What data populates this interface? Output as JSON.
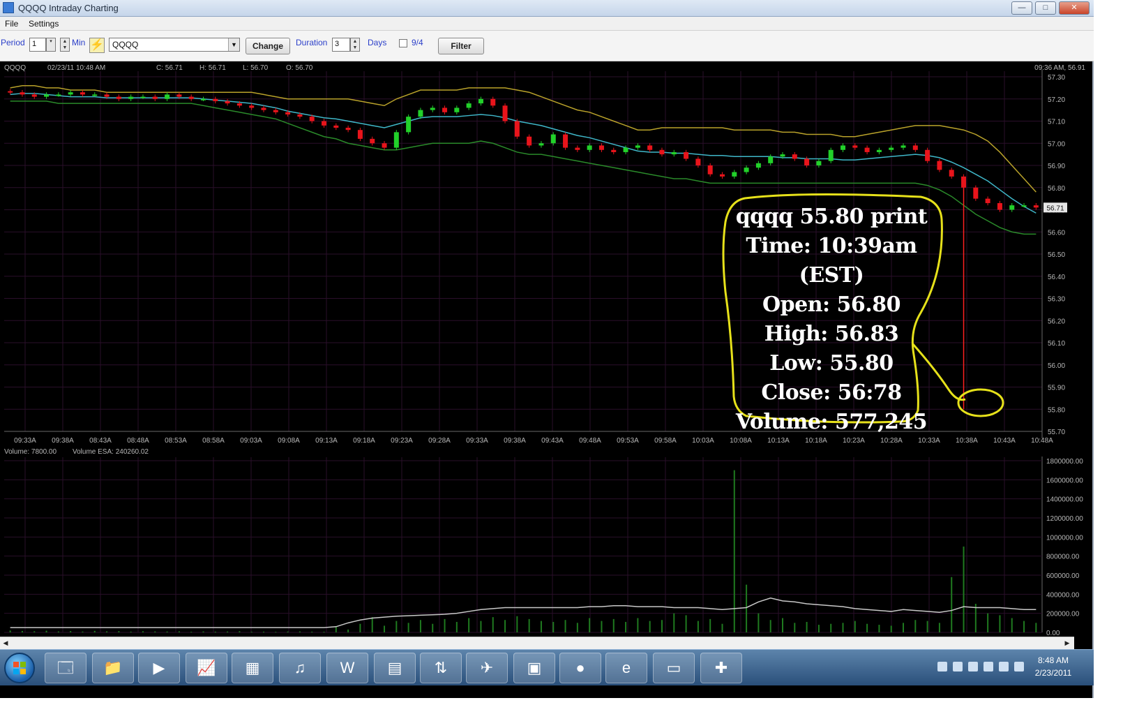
{
  "window": {
    "title": "QQQQ Intraday Charting",
    "controls": {
      "minimize": "—",
      "maximize": "□",
      "close": "✕"
    }
  },
  "menu": [
    "File",
    "Settings"
  ],
  "toolbar": {
    "period_label": "Period",
    "period_value": "1",
    "min_label": "Min",
    "symbol_value": "QQQQ",
    "change_label": "Change",
    "duration_label": "Duration",
    "duration_value": "3",
    "days_label": "Days",
    "checkbox_label": "9/4",
    "filter_label": "Filter"
  },
  "chart_header": {
    "symbol": "QQQQ",
    "datetime": "02/23/11 10:48 AM",
    "close": "C: 56.71",
    "high": "H: 56.71",
    "low": "L: 56.70",
    "open": "O: 56.70",
    "right": "09:36 AM, 56.91"
  },
  "price_axis": {
    "ticks": [
      "57.30",
      "57.20",
      "57.10",
      "57.00",
      "56.90",
      "56.80",
      "56.70",
      "56.60",
      "56.50",
      "56.40",
      "56.30",
      "56.20",
      "56.10",
      "56.00",
      "55.90",
      "55.80",
      "55.70"
    ],
    "current": "56.71"
  },
  "time_axis": [
    "09:33A",
    "09:38A",
    "08:43A",
    "08:48A",
    "08:53A",
    "08:58A",
    "09:03A",
    "09:08A",
    "09:13A",
    "09:18A",
    "09:23A",
    "09:28A",
    "09:33A",
    "09:38A",
    "09:43A",
    "09:48A",
    "09:53A",
    "09:58A",
    "10:03A",
    "10:08A",
    "10:13A",
    "10:18A",
    "10:23A",
    "10:28A",
    "10:33A",
    "10:38A",
    "10:43A",
    "10:48A"
  ],
  "volume_header": {
    "volume": "Volume: 7800.00",
    "volume_esa": "Volume ESA: 240260.02"
  },
  "volume_axis": [
    "1800000.00",
    "1600000.00",
    "1400000.00",
    "1200000.00",
    "1000000.00",
    "800000.00",
    "600000.00",
    "400000.00",
    "200000.00",
    "0.00"
  ],
  "annotation": {
    "lines": [
      "qqqq 55.80 print",
      "Time: 10:39am (EST)",
      "Open: 56.80",
      "High: 56.83",
      "Low: 55.80",
      "Close: 56:78",
      "Volume: 577,245"
    ],
    "color": "#e6e11a"
  },
  "colors": {
    "up": "#22d12a",
    "down": "#e8141b",
    "band_upper": "#b9a22a",
    "band_lower": "#2a8a2a",
    "ma": "#3fb7c9",
    "grid": "#2a0f2a",
    "axis_text": "#b8b8b8",
    "spike": "#ff2020"
  },
  "chart_data": {
    "type": "candlestick",
    "title": "",
    "ylim": [
      55.7,
      57.3
    ],
    "spike_low": 55.8,
    "candles_close": [
      57.23,
      57.22,
      57.21,
      57.22,
      57.22,
      57.23,
      57.22,
      57.22,
      57.21,
      57.2,
      57.21,
      57.21,
      57.2,
      57.22,
      57.21,
      57.2,
      57.2,
      57.19,
      57.18,
      57.17,
      57.16,
      57.15,
      57.14,
      57.13,
      57.12,
      57.1,
      57.08,
      57.07,
      57.06,
      57.02,
      57.0,
      56.98,
      57.05,
      57.12,
      57.15,
      57.16,
      57.14,
      57.16,
      57.18,
      57.2,
      57.17,
      57.1,
      57.03,
      56.99,
      57.0,
      57.04,
      56.98,
      56.97,
      56.99,
      56.97,
      56.96,
      56.98,
      56.99,
      56.97,
      56.95,
      56.96,
      56.93,
      56.9,
      56.86,
      56.85,
      56.87,
      56.89,
      56.91,
      56.94,
      56.95,
      56.93,
      56.9,
      56.92,
      56.97,
      56.99,
      56.98,
      56.96,
      56.97,
      56.98,
      56.99,
      56.97,
      56.92,
      56.88,
      56.85,
      56.8,
      56.75,
      56.73,
      56.7,
      56.72,
      56.72,
      56.71
    ],
    "upper_band": [
      57.25,
      57.26,
      57.26,
      57.25,
      57.25,
      57.24,
      57.24,
      57.24,
      57.23,
      57.23,
      57.23,
      57.23,
      57.23,
      57.23,
      57.23,
      57.23,
      57.23,
      57.23,
      57.23,
      57.23,
      57.23,
      57.22,
      57.21,
      57.2,
      57.2,
      57.2,
      57.2,
      57.2,
      57.2,
      57.19,
      57.18,
      57.17,
      57.2,
      57.22,
      57.24,
      57.24,
      57.24,
      57.24,
      57.25,
      57.25,
      57.25,
      57.25,
      57.24,
      57.23,
      57.21,
      57.19,
      57.17,
      57.15,
      57.14,
      57.12,
      57.1,
      57.08,
      57.06,
      57.06,
      57.07,
      57.07,
      57.07,
      57.07,
      57.07,
      57.07,
      57.06,
      57.06,
      57.06,
      57.06,
      57.05,
      57.05,
      57.04,
      57.04,
      57.04,
      57.03,
      57.03,
      57.04,
      57.05,
      57.06,
      57.07,
      57.08,
      57.08,
      57.08,
      57.07,
      57.06,
      57.04,
      57.01,
      56.96,
      56.9,
      56.84,
      56.78
    ],
    "lower_band": [
      57.19,
      57.19,
      57.19,
      57.19,
      57.18,
      57.18,
      57.18,
      57.18,
      57.18,
      57.18,
      57.18,
      57.18,
      57.18,
      57.18,
      57.18,
      57.18,
      57.17,
      57.16,
      57.15,
      57.14,
      57.13,
      57.12,
      57.11,
      57.09,
      57.07,
      57.05,
      57.03,
      57.02,
      57.0,
      56.99,
      56.98,
      56.97,
      56.97,
      56.98,
      56.99,
      57.0,
      57.0,
      57.0,
      57.0,
      57.01,
      57.0,
      56.98,
      56.96,
      56.95,
      56.95,
      56.94,
      56.93,
      56.92,
      56.91,
      56.9,
      56.89,
      56.88,
      56.87,
      56.86,
      56.85,
      56.84,
      56.84,
      56.83,
      56.82,
      56.82,
      56.82,
      56.82,
      56.82,
      56.82,
      56.82,
      56.82,
      56.82,
      56.82,
      56.82,
      56.82,
      56.82,
      56.82,
      56.82,
      56.82,
      56.82,
      56.82,
      56.81,
      56.79,
      56.76,
      56.72,
      56.68,
      56.65,
      56.62,
      56.6,
      56.59,
      56.59
    ],
    "volume": [
      20000,
      15000,
      12000,
      18000,
      10000,
      14000,
      9000,
      16000,
      11000,
      13000,
      8000,
      12000,
      10000,
      9000,
      11000,
      7000,
      10000,
      8000,
      9000,
      12000,
      7000,
      8000,
      6000,
      9000,
      10000,
      8000,
      7000,
      60000,
      30000,
      90000,
      160000,
      70000,
      120000,
      100000,
      130000,
      90000,
      140000,
      110000,
      150000,
      120000,
      160000,
      130000,
      170000,
      140000,
      120000,
      110000,
      130000,
      100000,
      150000,
      120000,
      140000,
      110000,
      150000,
      120000,
      130000,
      200000,
      180000,
      120000,
      140000,
      90000,
      1700000,
      500000,
      200000,
      130000,
      150000,
      100000,
      110000,
      80000,
      90000,
      100000,
      120000,
      90000,
      80000,
      70000,
      100000,
      130000,
      120000,
      100000,
      580000,
      900000,
      300000,
      200000,
      180000,
      150000,
      120000,
      100000
    ],
    "volume_esa": [
      50000,
      50000,
      50000,
      50000,
      50000,
      50000,
      50000,
      50000,
      50000,
      50000,
      50000,
      50000,
      50000,
      50000,
      50000,
      50000,
      50000,
      50000,
      50000,
      50000,
      50000,
      50000,
      50000,
      50000,
      50000,
      50000,
      50000,
      60000,
      100000,
      130000,
      150000,
      160000,
      170000,
      175000,
      180000,
      185000,
      190000,
      200000,
      220000,
      240000,
      250000,
      260000,
      260000,
      260000,
      260000,
      260000,
      260000,
      260000,
      270000,
      270000,
      280000,
      280000,
      270000,
      270000,
      270000,
      260000,
      260000,
      260000,
      250000,
      240000,
      250000,
      260000,
      320000,
      360000,
      330000,
      320000,
      300000,
      290000,
      280000,
      270000,
      250000,
      240000,
      230000,
      220000,
      240000,
      230000,
      220000,
      210000,
      230000,
      270000,
      260000,
      260000,
      260000,
      250000,
      240000,
      240000
    ]
  }
}
